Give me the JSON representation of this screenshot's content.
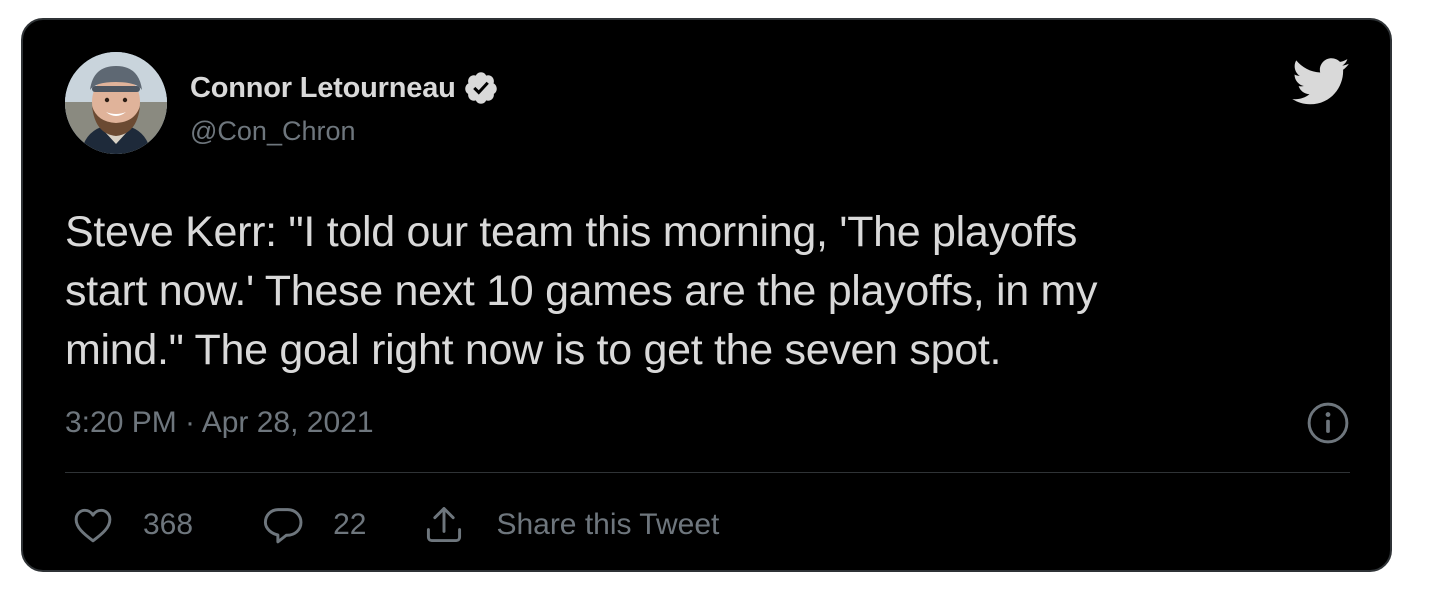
{
  "author": {
    "display_name": "Connor Letourneau",
    "handle": "@Con_Chron",
    "verified_icon": "verified-badge-icon",
    "avatar": "profile-photo"
  },
  "brand": {
    "logo_icon": "twitter-bird-icon",
    "colors": {
      "background": "#000000",
      "text": "#d9d9d9",
      "secondary_text": "#6e767d",
      "border": "#2f3336"
    }
  },
  "tweet": {
    "text_line_1": "Steve Kerr: \"I told our team this morning, 'The playoffs",
    "text_line_2": "start now.' These next 10 games are the playoffs, in my",
    "text_line_3": "mind.\" The goal right now is to get the seven spot.",
    "timestamp": "3:20 PM · Apr 28, 2021",
    "info_icon": "info-icon"
  },
  "actions": {
    "likes": {
      "icon": "heart-icon",
      "count": "368"
    },
    "replies": {
      "icon": "reply-bubble-icon",
      "count": "22"
    },
    "share": {
      "icon": "share-upload-icon",
      "label": "Share this Tweet"
    }
  }
}
